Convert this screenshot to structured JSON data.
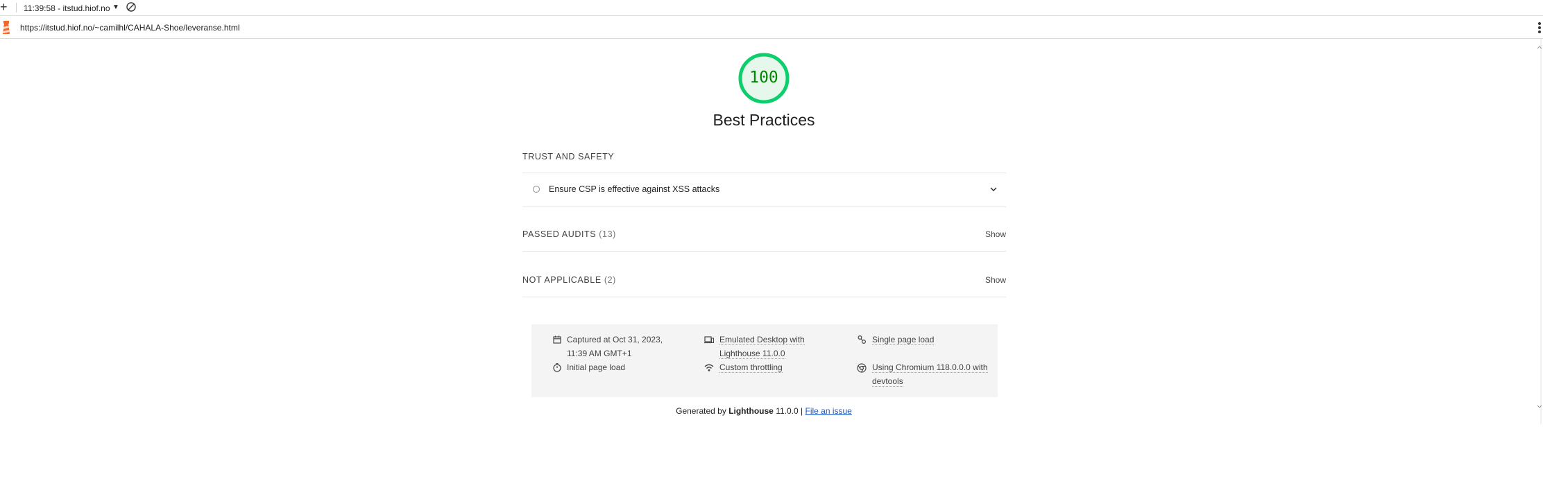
{
  "toolbar": {
    "session_label": "11:39:58 - itstud.hiof.no"
  },
  "urlbar": {
    "url": "https://itstud.hiof.no/~camilhl/CAHALA-Shoe/leveranse.html"
  },
  "report": {
    "score": "100",
    "category_title": "Best Practices",
    "colors": {
      "pass": "#0cce6b",
      "pass_fill": "#e6f7ec",
      "pass_text": "#008800"
    },
    "group": {
      "title": "TRUST AND SAFETY",
      "audits": [
        {
          "title": "Ensure CSP is effective against XSS attacks"
        }
      ]
    },
    "passed": {
      "label": "PASSED AUDITS",
      "count": "(13)",
      "toggle": "Show"
    },
    "not_applicable": {
      "label": "NOT APPLICABLE",
      "count": "(2)",
      "toggle": "Show"
    }
  },
  "meta": {
    "captured": "Captured at Oct 31, 2023, 11:39 AM GMT+1",
    "initial_load": "Initial page load",
    "emulated": "Emulated Desktop with Lighthouse 11.0.0",
    "throttling": "Custom throttling",
    "single_load": "Single page load",
    "chromium": "Using Chromium 118.0.0.0 with devtools"
  },
  "footer": {
    "generated_by": "Generated by",
    "brand": "Lighthouse",
    "version": "11.0.0 |",
    "file_issue": "File an issue"
  }
}
